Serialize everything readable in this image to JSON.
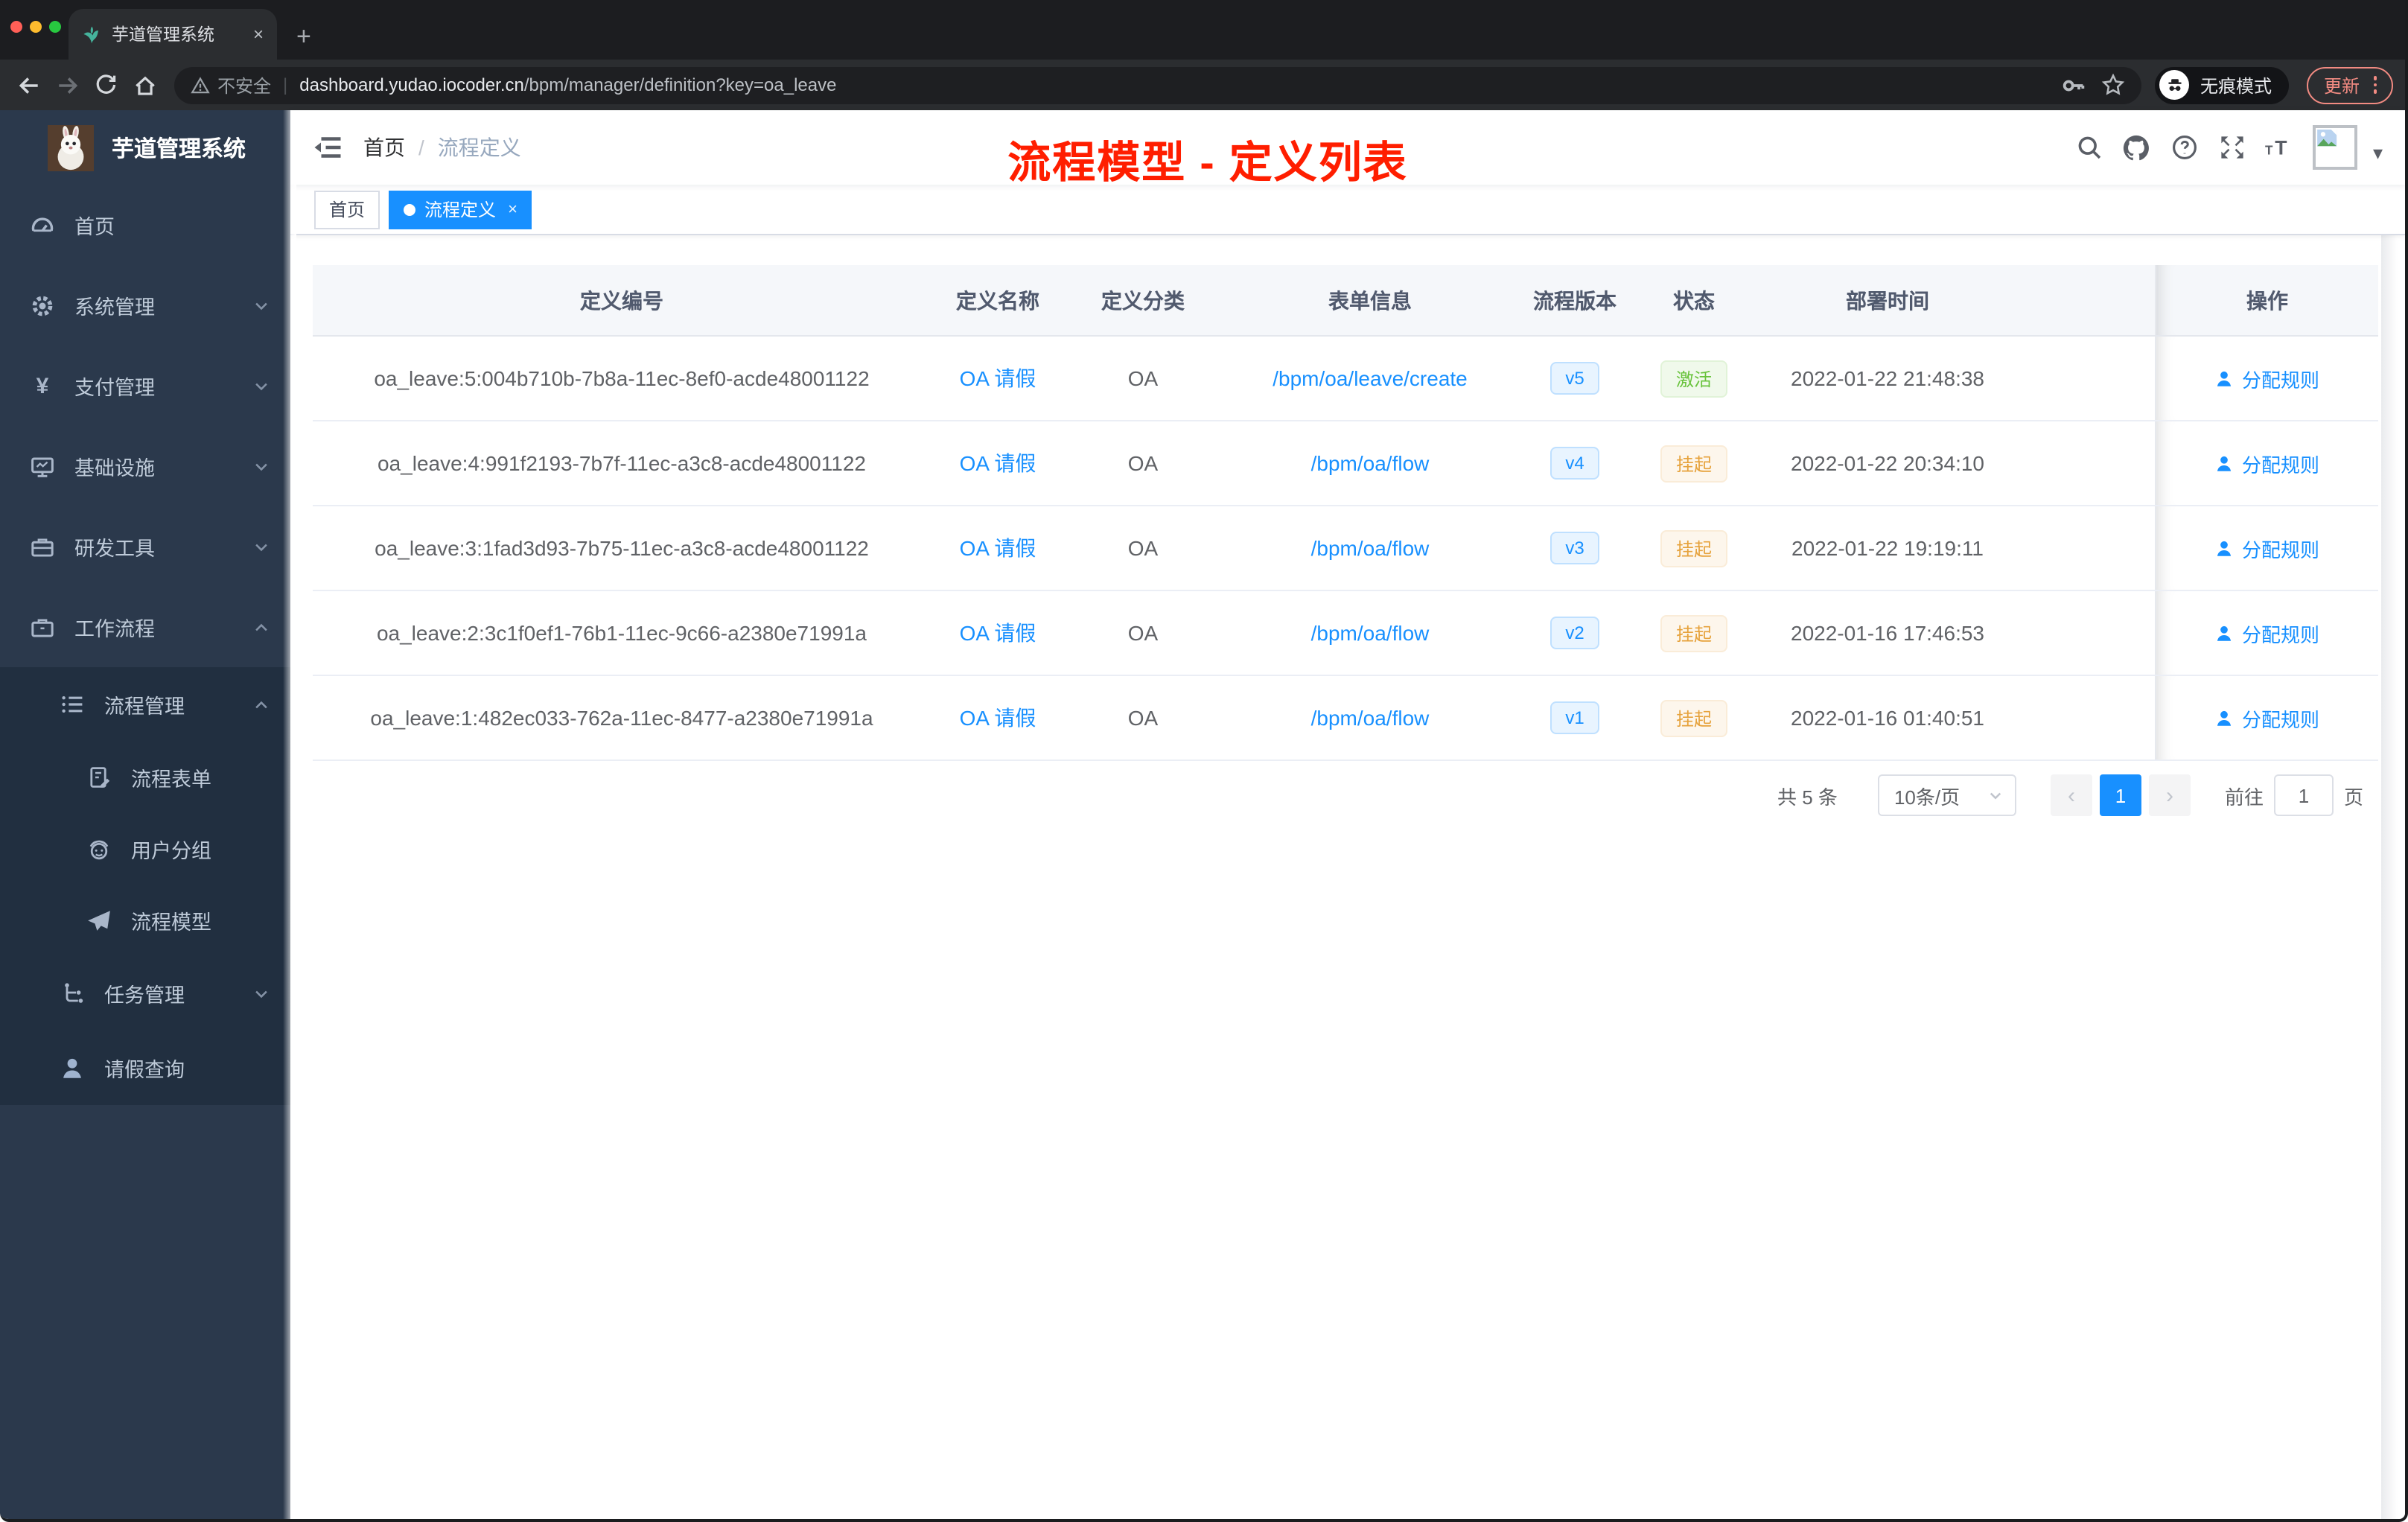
{
  "browser": {
    "tab_title": "芋道管理系统",
    "close_tab_glyph": "×",
    "new_tab_glyph": "+",
    "security_label": "不安全",
    "url_host": "dashboard.yudao.iocoder.cn",
    "url_path": "/bpm/manager/definition?key=oa_leave",
    "incognito_label": "无痕模式",
    "update_label": "更新"
  },
  "sidebar": {
    "logo_title": "芋道管理系统",
    "menu": [
      {
        "label": "首页"
      },
      {
        "label": "系统管理"
      },
      {
        "label": "支付管理"
      },
      {
        "label": "基础设施"
      },
      {
        "label": "研发工具"
      },
      {
        "label": "工作流程"
      },
      {
        "label": "流程管理"
      },
      {
        "label": "流程表单"
      },
      {
        "label": "用户分组"
      },
      {
        "label": "流程模型"
      },
      {
        "label": "任务管理"
      },
      {
        "label": "请假查询"
      }
    ]
  },
  "navbar": {
    "breadcrumb_home": "首页",
    "breadcrumb_separator": "/",
    "breadcrumb_current": "流程定义"
  },
  "tags": [
    {
      "label": "首页"
    },
    {
      "label": "流程定义",
      "close_glyph": "×"
    }
  ],
  "annotation": {
    "text": "流程模型 - 定义列表",
    "color": "#ff1e00"
  },
  "table": {
    "columns": [
      "定义编号",
      "定义名称",
      "定义分类",
      "表单信息",
      "流程版本",
      "状态",
      "部署时间",
      "操作"
    ],
    "rows": [
      {
        "id": "oa_leave:5:004b710b-7b8a-11ec-8ef0-acde48001122",
        "name": "OA 请假",
        "category": "OA",
        "form": "/bpm/oa/leave/create",
        "version": "v5",
        "status": "激活",
        "status_type": "success",
        "deployed_at": "2022-01-22 21:48:38",
        "action": "分配规则"
      },
      {
        "id": "oa_leave:4:991f2193-7b7f-11ec-a3c8-acde48001122",
        "name": "OA 请假",
        "category": "OA",
        "form": "/bpm/oa/flow",
        "version": "v4",
        "status": "挂起",
        "status_type": "warning",
        "deployed_at": "2022-01-22 20:34:10",
        "action": "分配规则"
      },
      {
        "id": "oa_leave:3:1fad3d93-7b75-11ec-a3c8-acde48001122",
        "name": "OA 请假",
        "category": "OA",
        "form": "/bpm/oa/flow",
        "version": "v3",
        "status": "挂起",
        "status_type": "warning",
        "deployed_at": "2022-01-22 19:19:11",
        "action": "分配规则"
      },
      {
        "id": "oa_leave:2:3c1f0ef1-76b1-11ec-9c66-a2380e71991a",
        "name": "OA 请假",
        "category": "OA",
        "form": "/bpm/oa/flow",
        "version": "v2",
        "status": "挂起",
        "status_type": "warning",
        "deployed_at": "2022-01-16 17:46:53",
        "action": "分配规则"
      },
      {
        "id": "oa_leave:1:482ec033-762a-11ec-8477-a2380e71991a",
        "name": "OA 请假",
        "category": "OA",
        "form": "/bpm/oa/flow",
        "version": "v1",
        "status": "挂起",
        "status_type": "warning",
        "deployed_at": "2022-01-16 01:40:51",
        "action": "分配规则"
      }
    ]
  },
  "pagination": {
    "total_label": "共 5 条",
    "page_size_label": "10条/页",
    "prev_glyph": "‹",
    "next_glyph": "›",
    "current_page": "1",
    "goto_label": "前往",
    "goto_value": "1",
    "page_unit": "页"
  },
  "colors": {
    "primary": "#1890ff",
    "success": "#67c23a",
    "warning": "#e6a23c",
    "annotation_red": "#ff1e00"
  }
}
